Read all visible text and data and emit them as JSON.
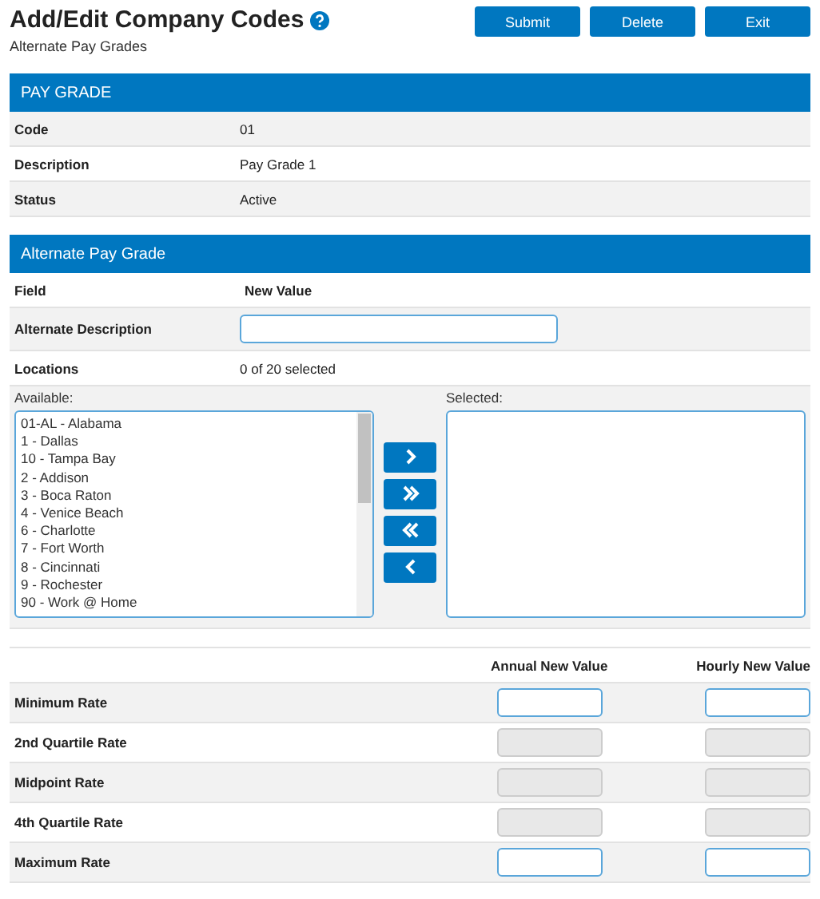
{
  "header": {
    "title": "Add/Edit Company Codes",
    "subtitle": "Alternate Pay Grades",
    "buttons": [
      "Submit",
      "Delete",
      "Exit"
    ]
  },
  "pay_grade": {
    "title": "PAY GRADE",
    "rows": [
      {
        "label": "Code",
        "value": "01"
      },
      {
        "label": "Description",
        "value": "Pay Grade 1"
      },
      {
        "label": "Status",
        "value": "Active"
      }
    ]
  },
  "alternate": {
    "title": "Alternate Pay Grade",
    "field_header": "Field",
    "value_header": "New Value",
    "description_label": "Alternate Description",
    "locations_label": "Locations",
    "locations_value": "0 of 20 selected",
    "available_label": "Available:",
    "selected_label": "Selected:",
    "available": [
      "01-AL - Alabama",
      "1 - Dallas",
      "10 - Tampa Bay",
      "2 - Addison",
      "3 - Boca Raton",
      "4 - Venice Beach",
      "6 - Charlotte",
      "7 - Fort Worth",
      "8 - Cincinnati",
      "9 - Rochester",
      "90 - Work @ Home"
    ],
    "move_buttons": [
      {
        "kind": "one-right"
      },
      {
        "kind": "all-right"
      },
      {
        "kind": "all-left"
      },
      {
        "kind": "one-left"
      }
    ]
  },
  "rates": {
    "columns": [
      "Annual New Value",
      "Hourly New Value"
    ],
    "rows": [
      {
        "label": "Minimum Rate",
        "disabled": false
      },
      {
        "label": "2nd Quartile Rate",
        "disabled": true
      },
      {
        "label": "Midpoint Rate",
        "disabled": true
      },
      {
        "label": "4th Quartile Rate",
        "disabled": true
      },
      {
        "label": "Maximum Rate",
        "disabled": false
      }
    ]
  }
}
